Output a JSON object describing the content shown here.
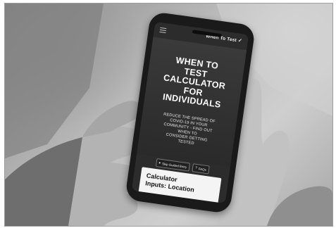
{
  "app": {
    "brand": "When To Test",
    "brand_icon": "check-mark-icon"
  },
  "hero": {
    "title_lines": [
      "WHEN TO",
      "TEST",
      "CALCULATOR",
      "FOR",
      "INDIVIDUALS"
    ],
    "subtitle_lines": [
      "REDUCE THE SPREAD OF",
      "COVID-19 IN YOUR",
      "COMMUNITY - FIND OUT",
      "WHEN TO",
      "CONSIDER GETTING",
      "TESTED"
    ]
  },
  "chips": {
    "skip_label": "Skip Guided Entry",
    "faqs_label": "FAQs"
  },
  "card": {
    "title_lines": [
      "Calculator",
      "Inputs: Location"
    ]
  },
  "colors": {
    "screen_bg": "#2c2c2c",
    "text_light": "#ffffff",
    "card_bg": "#f4f4f4"
  }
}
